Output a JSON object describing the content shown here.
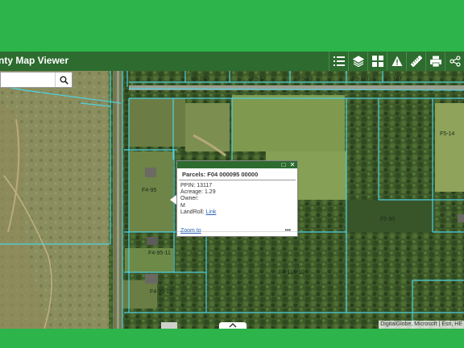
{
  "app": {
    "title": "nty Map Viewer"
  },
  "toolbar": [
    {
      "name": "legend-list-icon"
    },
    {
      "name": "layers-icon"
    },
    {
      "name": "basemap-gallery-icon"
    },
    {
      "name": "warning-icon"
    },
    {
      "name": "measure-ruler-icon"
    },
    {
      "name": "print-icon"
    },
    {
      "name": "share-icon"
    }
  ],
  "search": {
    "value": "",
    "placeholder": ""
  },
  "popup": {
    "title": "Parcels: F04 000095 00000",
    "ppin": "PPIN: 13117",
    "acreage": "Acreage: 1.29",
    "owner": "Owner:",
    "owner_value": "M",
    "landroll_label": "LandRoll:",
    "landroll_link": "Link",
    "zoom_to": "Zoom to",
    "more": "•••"
  },
  "parcel_labels": [
    "F5-200",
    "F5-12",
    "F5-13",
    "F5-12/10",
    "F5-127",
    "F5-14",
    "F4-95",
    "F5-90",
    "F4-95-11",
    "F4-116-10",
    "F4-95-10",
    "F5-10"
  ],
  "attribution": "DigitalGlobe, Microsoft | Esri, HE",
  "colors": {
    "band": "#2db44a",
    "header": "#2d6b2f",
    "parcel_line": "#4fd1e0"
  }
}
